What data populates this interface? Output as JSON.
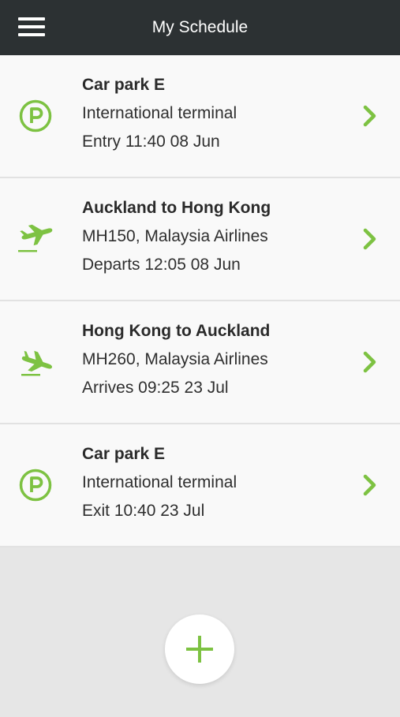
{
  "header": {
    "title": "My Schedule",
    "menu_icon": "hamburger-menu-icon"
  },
  "colors": {
    "header_bg": "#2c3133",
    "accent": "#7dc242",
    "card_bg": "#f9f9f9",
    "page_bg": "#e6e6e6"
  },
  "schedule": {
    "items": [
      {
        "icon": "parking-icon",
        "title": "Car park E",
        "line2": "International terminal",
        "line3": "Entry 11:40 08 Jun"
      },
      {
        "icon": "departure-plane-icon",
        "title": "Auckland to Hong Kong",
        "line2": "MH150, Malaysia Airlines",
        "line3": "Departs 12:05 08 Jun"
      },
      {
        "icon": "arrival-plane-icon",
        "title": "Hong Kong to Auckland",
        "line2": "MH260, Malaysia Airlines",
        "line3": "Arrives 09:25 23 Jul"
      },
      {
        "icon": "parking-icon",
        "title": "Car park E",
        "line2": "International terminal",
        "line3": "Exit 10:40 23 Jul"
      }
    ]
  },
  "fab": {
    "icon": "plus-icon"
  }
}
